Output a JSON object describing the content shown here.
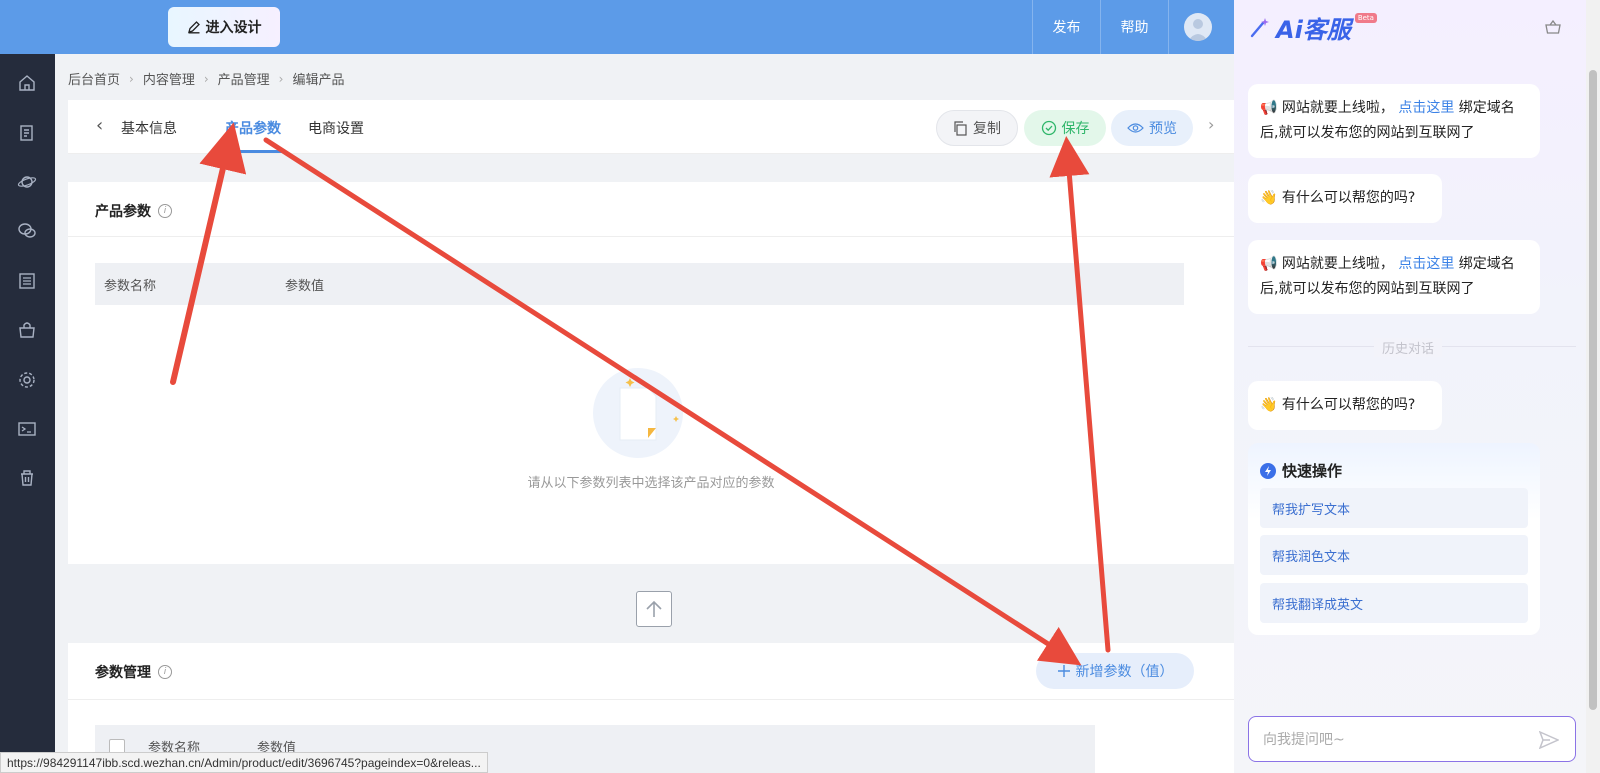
{
  "topbar": {
    "design_button": "进入设计",
    "publish": "发布",
    "help": "帮助"
  },
  "breadcrumb": [
    "后台首页",
    "内容管理",
    "产品管理",
    "编辑产品"
  ],
  "tabs": {
    "basic": "基本信息",
    "params": "产品参数",
    "ecommerce": "电商设置"
  },
  "actions": {
    "copy": "复制",
    "save": "保存",
    "preview": "预览"
  },
  "product_params": {
    "title": "产品参数",
    "col_name": "参数名称",
    "col_value": "参数值",
    "empty_text": "请从以下参数列表中选择该产品对应的参数"
  },
  "param_manage": {
    "title": "参数管理",
    "add_button": "新增参数（值）",
    "col_name": "参数名称",
    "col_value": "参数值"
  },
  "ai": {
    "brand": "Ai客服",
    "beta": "Beta",
    "msg1_text": "网站就要上线啦，",
    "msg1_link": "点击这里",
    "msg1_rest": "绑定域名后,就可以发布您的网站到互联网了",
    "msg2": "有什么可以帮您的吗?",
    "msg3_text": "网站就要上线啦，",
    "msg3_link": "点击这里",
    "msg3_rest": "绑定域名后,就可以发布您的网站到互联网了",
    "history": "历史对话",
    "msg4": "有什么可以帮您的吗?",
    "quick_title": "快速操作",
    "quick_items": [
      "帮我扩写文本",
      "帮我润色文本",
      "帮我翻译成英文"
    ],
    "input_placeholder": "向我提问吧~"
  },
  "status_url": "https://984291147ibb.scd.wezhan.cn/Admin/product/edit/3696745?pageindex=0&releas...",
  "colors": {
    "topbar": "#5c9be8",
    "sidebar": "#252c3c",
    "accent": "#4a8be0",
    "save_green": "#2fb66a",
    "arrow_red": "#e84a3c"
  }
}
